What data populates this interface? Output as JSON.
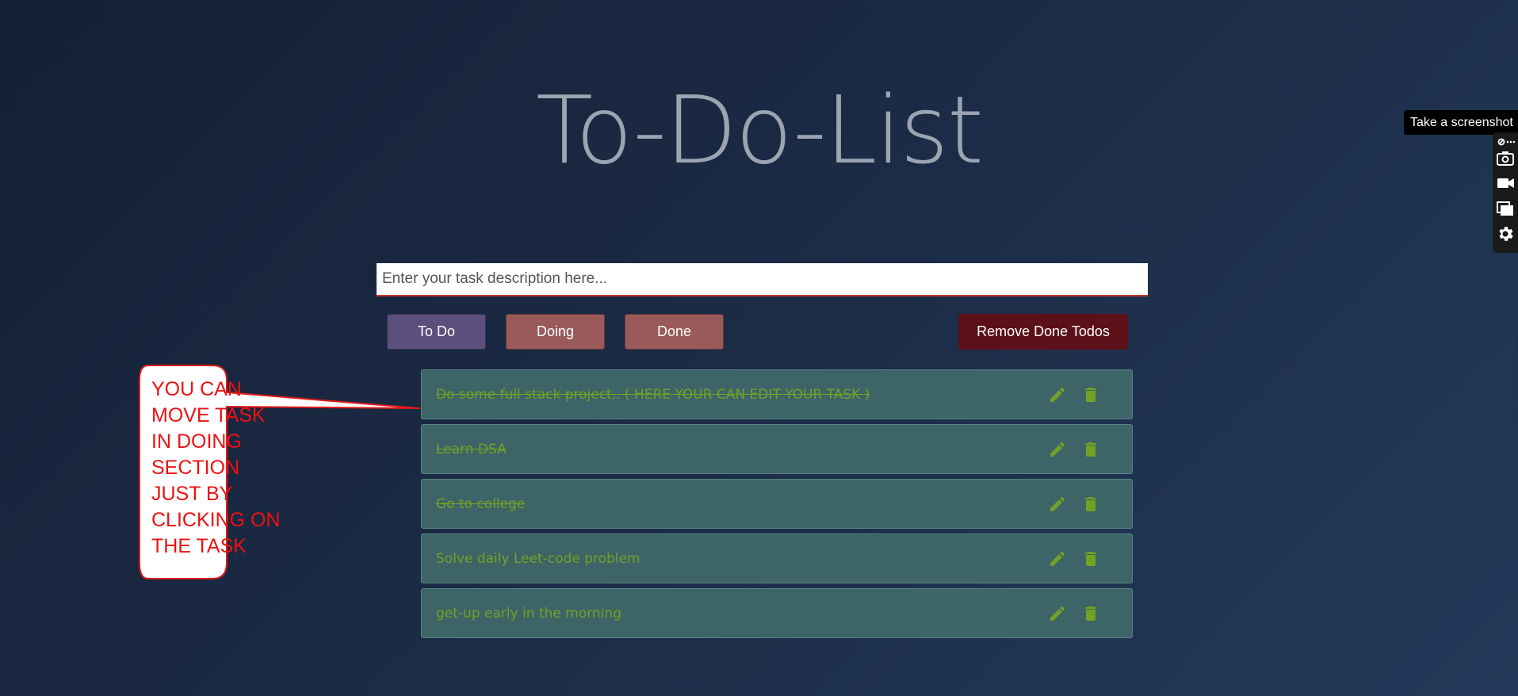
{
  "app": {
    "title": "To-Do-List"
  },
  "task_input": {
    "placeholder": "Enter your task description here...",
    "value": ""
  },
  "filters": {
    "todo_label": "To Do",
    "doing_label": "Doing",
    "done_label": "Done",
    "remove_done_label": "Remove Done Todos"
  },
  "tasks": [
    {
      "text": "Do some full stack project.. ( HERE YOUR CAN EDIT YOUR TASK )",
      "struck": true
    },
    {
      "text": "Learn DSA",
      "struck": true
    },
    {
      "text": "Go to college",
      "struck": true
    },
    {
      "text": "Solve daily Leet-code problem",
      "struck": false
    },
    {
      "text": "get-up early in the morning",
      "struck": false
    }
  ],
  "annotation": {
    "text": "YOU CAN\nMOVE TASK\nIN DOING\nSECTION\nJUST BY\nCLICKING ON\nTHE TASK"
  },
  "screenshot_toolbar": {
    "tooltip": "Take a screenshot",
    "icons": [
      "link-icon",
      "camera-icon",
      "video-icon",
      "window-icon",
      "gear-icon"
    ]
  },
  "colors": {
    "task_text": "#72a126",
    "task_background": "#3d6567",
    "annotation": "#ee1111",
    "todo_button": "#5a4f7d",
    "doing_done_button": "#9b5a5a",
    "remove_button": "#5c1118"
  }
}
